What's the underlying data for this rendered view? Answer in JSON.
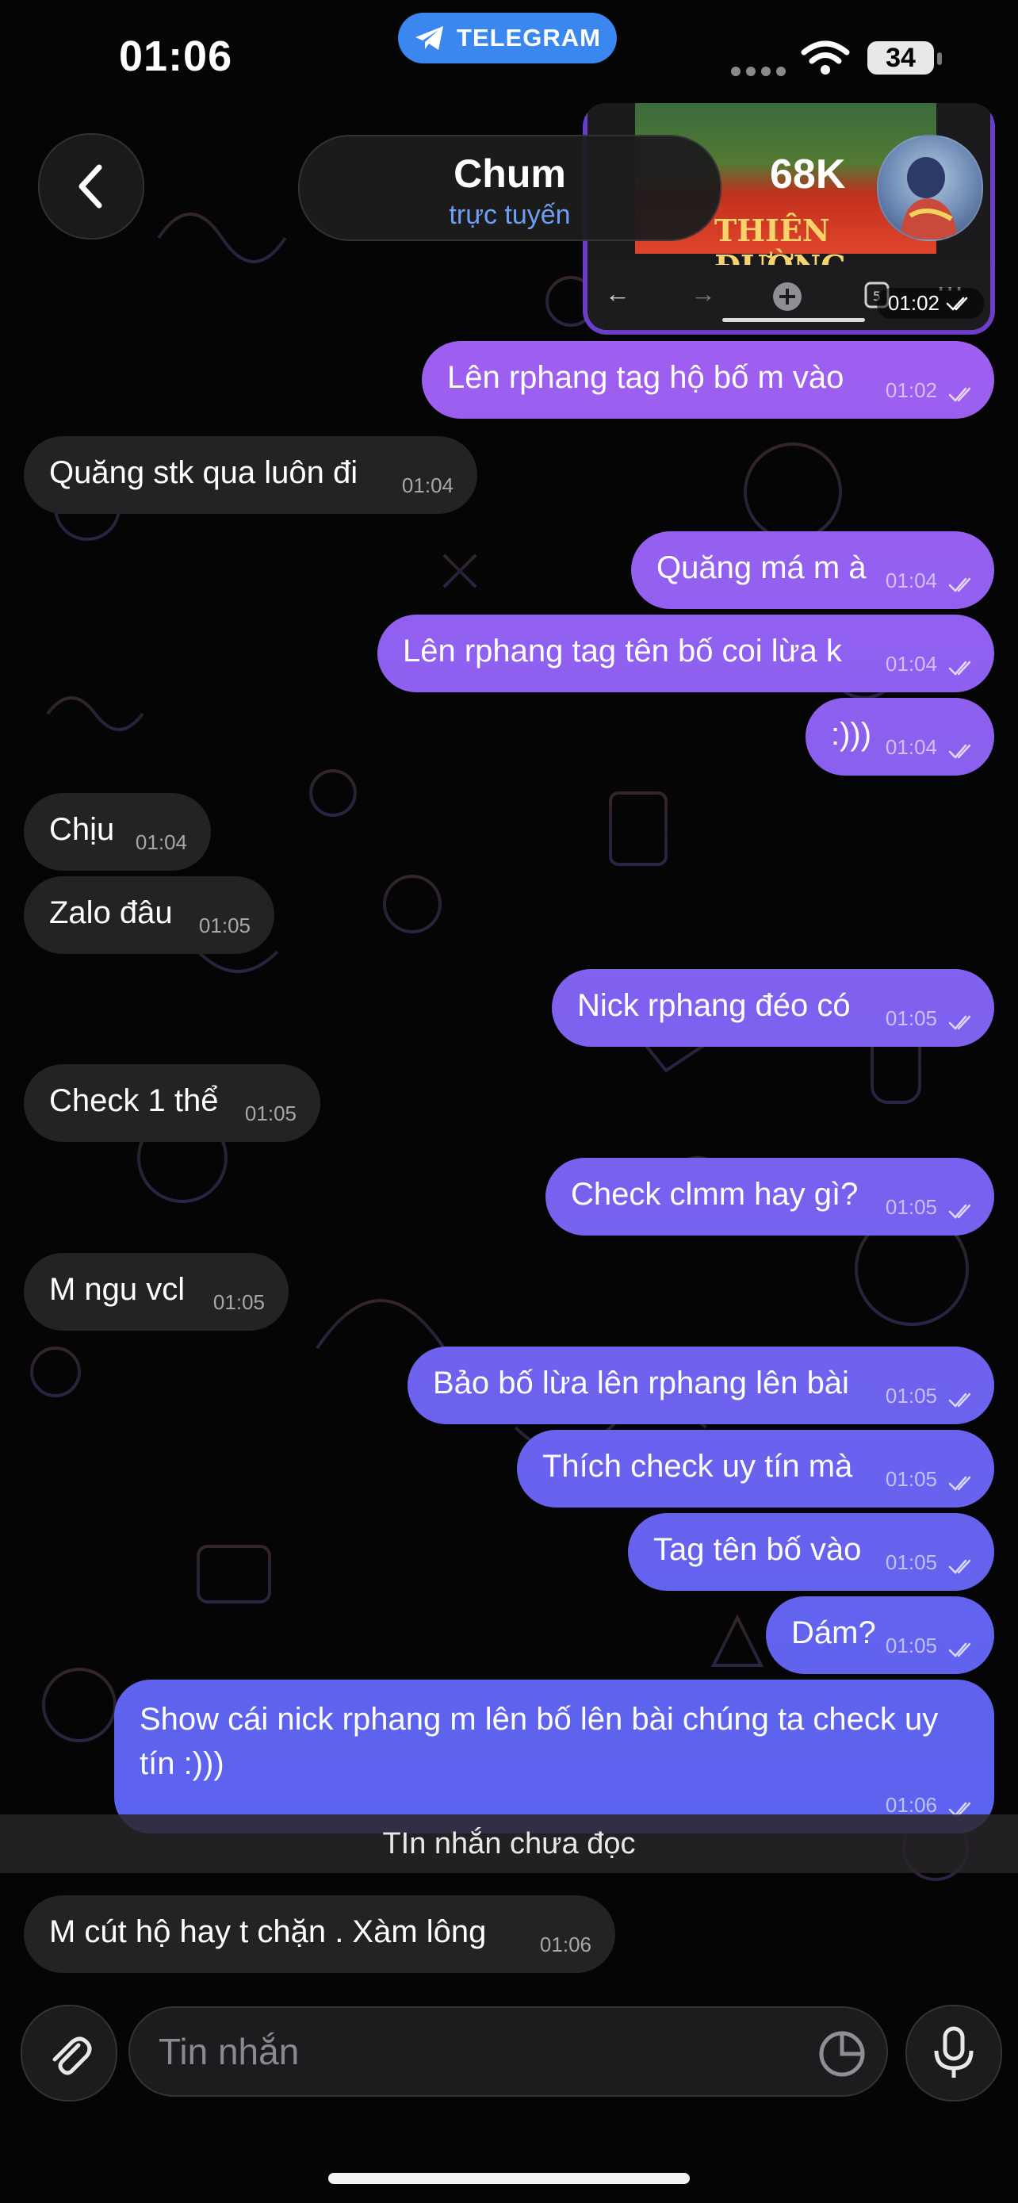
{
  "status_bar": {
    "time": "01:06",
    "app_pill": "TELEGRAM",
    "battery": "34"
  },
  "header": {
    "name": "Chum",
    "status": "trực tuyến"
  },
  "media": {
    "time": "01:02",
    "image_text": "THIÊN ĐƯỜNG",
    "image_price": "68K",
    "tab_count": "5"
  },
  "messages": [
    {
      "dir": "out",
      "text": "Lên rphang tag hộ bố m vào",
      "time": "01:02"
    },
    {
      "dir": "in",
      "text": "Quăng stk qua luôn đi",
      "time": "01:04"
    },
    {
      "dir": "out",
      "text": "Quăng má m à",
      "time": "01:04"
    },
    {
      "dir": "out",
      "text": "Lên rphang tag tên bố coi lừa k",
      "time": "01:04"
    },
    {
      "dir": "out",
      "text": ":)))",
      "time": "01:04"
    },
    {
      "dir": "in",
      "text": "Chịu",
      "time": "01:04"
    },
    {
      "dir": "in",
      "text": "Zalo đâu",
      "time": "01:05"
    },
    {
      "dir": "out",
      "text": "Nick rphang đéo có",
      "time": "01:05"
    },
    {
      "dir": "in",
      "text": "Check 1 thể",
      "time": "01:05"
    },
    {
      "dir": "out",
      "text": "Check clmm hay gì?",
      "time": "01:05"
    },
    {
      "dir": "in",
      "text": "M ngu vcl",
      "time": "01:05"
    },
    {
      "dir": "out",
      "text": "Bảo bố lừa lên rphang lên bài",
      "time": "01:05"
    },
    {
      "dir": "out",
      "text": "Thích check uy tín mà",
      "time": "01:05"
    },
    {
      "dir": "out",
      "text": "Tag tên bố vào",
      "time": "01:05"
    },
    {
      "dir": "out",
      "text": "Dám?",
      "time": "01:05"
    },
    {
      "dir": "out",
      "text": "Show cái nick rphang m lên bố lên bài chúng ta check uy tín :)))",
      "time": "01:06"
    },
    {
      "dir": "in",
      "text": "M cút hộ hay t chặn . Xàm lông",
      "time": "01:06"
    }
  ],
  "unread_divider": "TIn nhắn chưa đọc",
  "composer": {
    "placeholder": "Tin nhắn"
  },
  "colors": {
    "bubble_out_top": "#a05ff0",
    "bubble_out_bottom": "#5c63ee",
    "bubble_in": "#242224",
    "status_online": "#6e9ef5",
    "telegram_pill": "#3b87f0"
  }
}
